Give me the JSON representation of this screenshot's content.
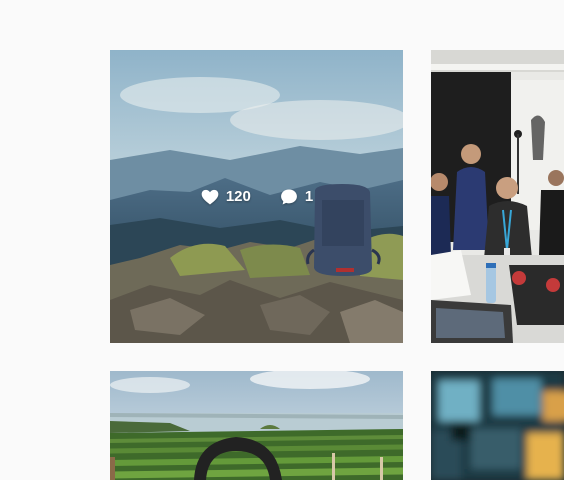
{
  "posts": [
    {
      "image": "mountain-backpack-photo",
      "likes": "120",
      "comments": "1",
      "hovered": true
    },
    {
      "image": "workshop-people-photo"
    },
    {
      "image": "vineyard-lake-photo"
    },
    {
      "image": "blurred-screens-photo"
    }
  ],
  "icons": {
    "like": "heart-icon",
    "comment": "comment-bubble-icon"
  }
}
